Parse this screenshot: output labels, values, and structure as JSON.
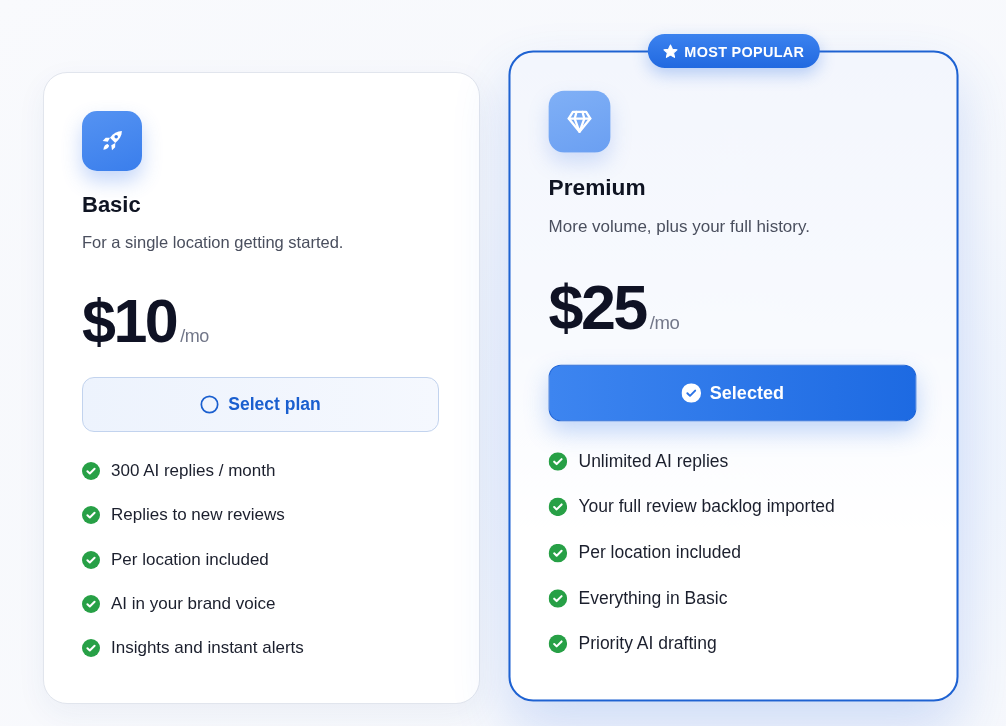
{
  "plans": [
    {
      "name": "Basic",
      "description": "For a single location getting started.",
      "price": "$10",
      "period": "/mo",
      "selected": false,
      "button": "Select plan",
      "features": [
        "300 AI replies / month",
        "Replies to new reviews",
        "Per location included",
        "AI in your brand voice",
        "Insights and instant alerts"
      ]
    },
    {
      "badge": "MOST POPULAR",
      "name": "Premium",
      "description": "More volume, plus your full history.",
      "price": "$25",
      "period": "/mo",
      "selected": true,
      "button": "Selected",
      "features": [
        "Unlimited AI replies",
        "Your full review backlog imported",
        "Per location included",
        "Everything in Basic",
        "Priority AI drafting"
      ]
    }
  ]
}
